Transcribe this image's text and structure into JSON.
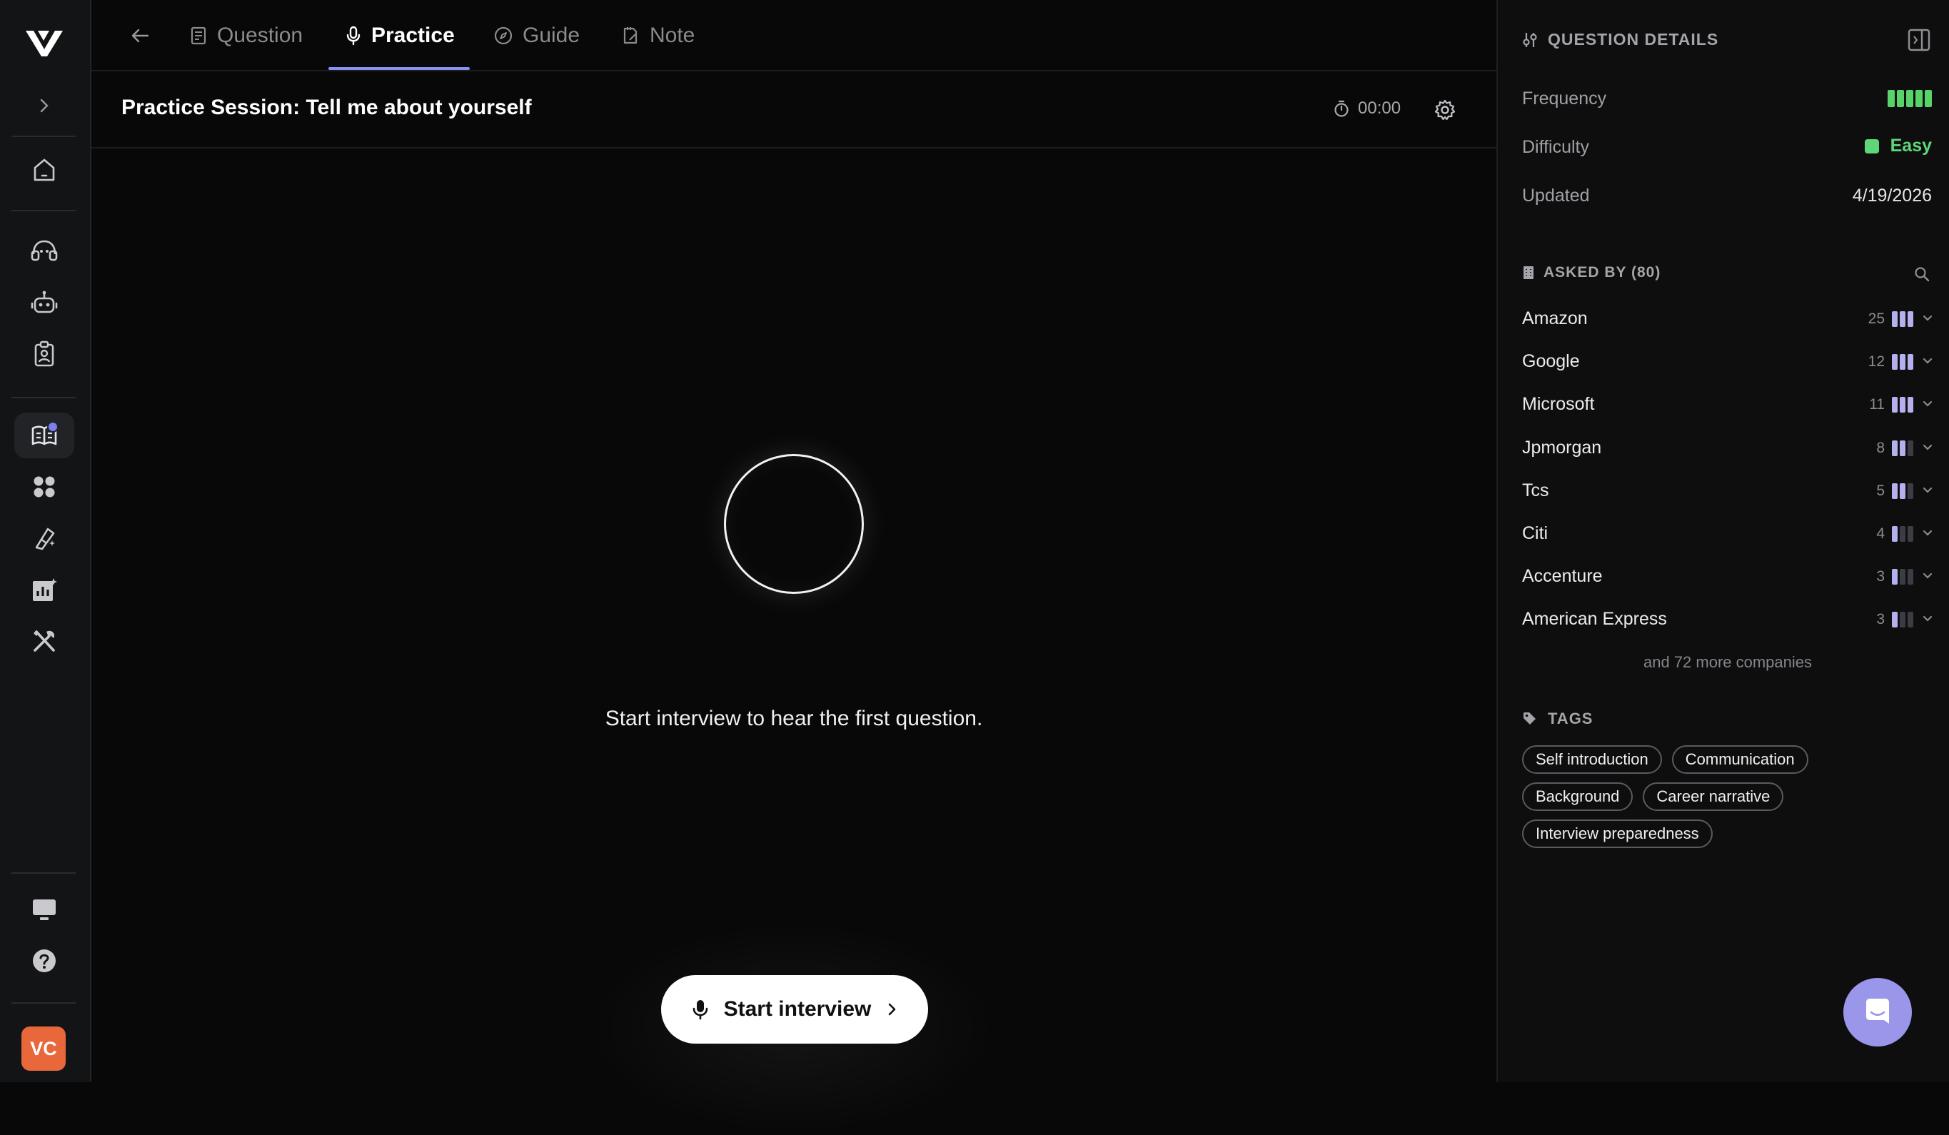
{
  "tabs": [
    {
      "label": "Question",
      "icon": "document-icon"
    },
    {
      "label": "Practice",
      "icon": "microphone-icon"
    },
    {
      "label": "Guide",
      "icon": "compass-icon"
    },
    {
      "label": "Note",
      "icon": "note-icon"
    }
  ],
  "session": {
    "title": "Practice Session: Tell me about yourself",
    "timer": "00:00"
  },
  "main": {
    "prompt": "Start interview to hear the first question.",
    "start_label": "Start interview"
  },
  "details": {
    "header": "QUESTION DETAILS",
    "frequency_label": "Frequency",
    "frequency_level": 5,
    "difficulty_label": "Difficulty",
    "difficulty_value": "Easy",
    "updated_label": "Updated",
    "updated_value": "4/19/2026"
  },
  "asked_by": {
    "header": "ASKED BY (80)",
    "companies": [
      {
        "name": "Amazon",
        "count": "25",
        "level": 3
      },
      {
        "name": "Google",
        "count": "12",
        "level": 3
      },
      {
        "name": "Microsoft",
        "count": "11",
        "level": 3
      },
      {
        "name": "Jpmorgan",
        "count": "8",
        "level": 2
      },
      {
        "name": "Tcs",
        "count": "5",
        "level": 2
      },
      {
        "name": "Citi",
        "count": "4",
        "level": 1
      },
      {
        "name": "Accenture",
        "count": "3",
        "level": 1
      },
      {
        "name": "American Express",
        "count": "3",
        "level": 1
      }
    ],
    "more": "and 72 more companies"
  },
  "tags": {
    "header": "TAGS",
    "items": [
      "Self introduction",
      "Communication",
      "Background",
      "Career narrative",
      "Interview preparedness"
    ]
  },
  "user": {
    "initials": "VC"
  },
  "colors": {
    "accent": "#8b8ff2",
    "easy": "#5fd679",
    "frequency": "#58d36a",
    "company_bar": "#b4b1ee",
    "avatar": "#e8683c",
    "chat": "#9a97ea"
  }
}
